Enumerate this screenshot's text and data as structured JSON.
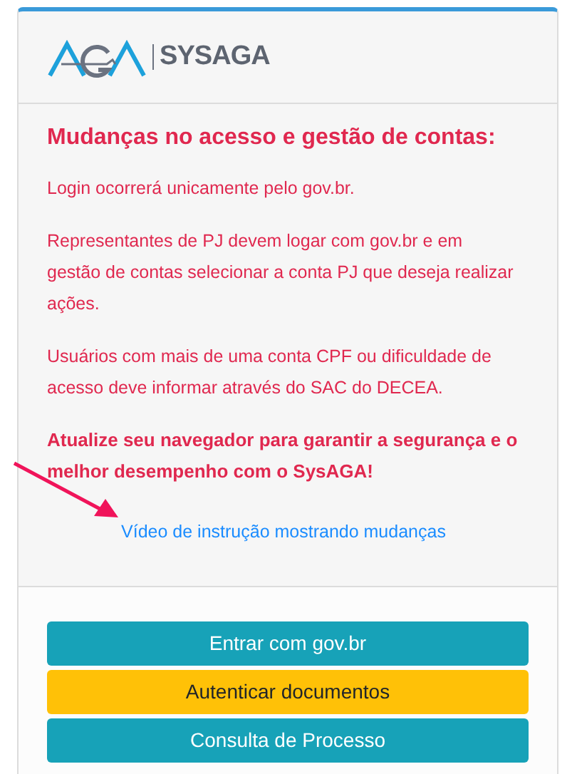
{
  "logo": {
    "text": "SYSAGA"
  },
  "notice": {
    "title": "Mudanças no acesso e gestão de contas:",
    "paragraphs": [
      {
        "text": "Login ocorrerá unicamente pelo gov.br.",
        "bold": false
      },
      {
        "text": "Representantes de PJ devem logar com gov.br e em gestão de contas selecionar a conta PJ que deseja realizar ações.",
        "bold": false
      },
      {
        "text": "Usuários com mais de uma conta CPF ou dificuldade de acesso deve informar através do SAC do DECEA.",
        "bold": false
      },
      {
        "text": "Atualize seu navegador para garantir a segurança e o melhor desempenho com o SysAGA!",
        "bold": true
      }
    ],
    "link": "Vídeo de instrução mostrando mudanças"
  },
  "buttons": [
    {
      "label": "Entrar com gov.br",
      "kind": "info"
    },
    {
      "label": "Autenticar documentos",
      "kind": "warning"
    },
    {
      "label": "Consulta de Processo",
      "kind": "info"
    }
  ]
}
